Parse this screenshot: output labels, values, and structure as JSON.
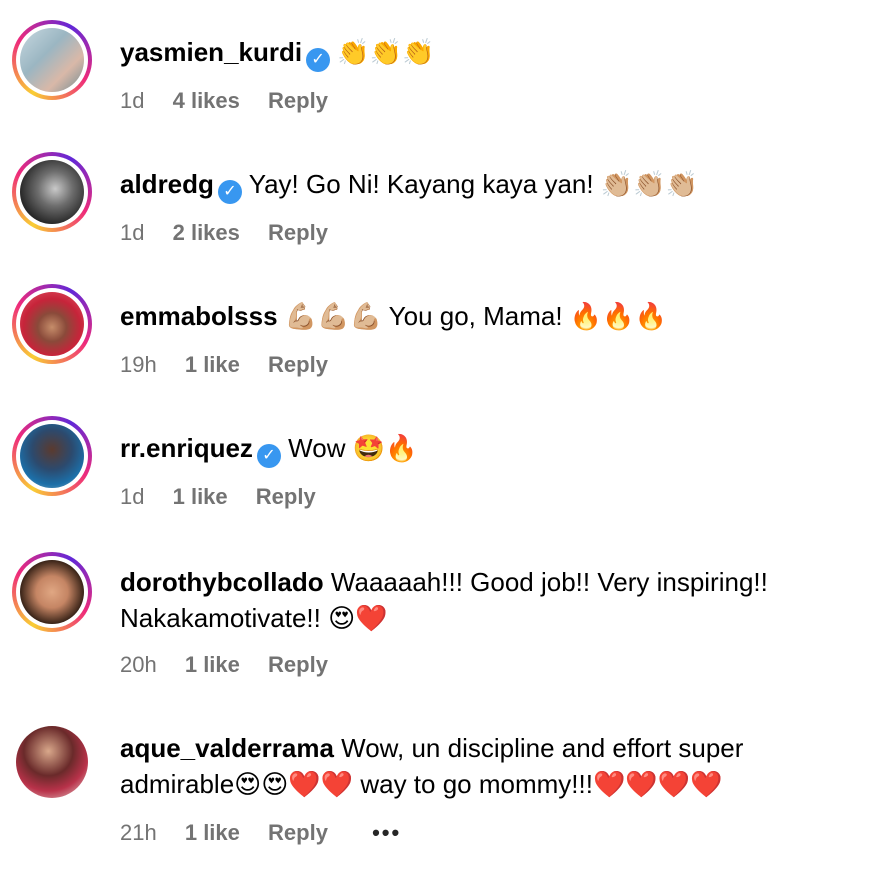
{
  "comments": [
    {
      "username": "yasmien_kurdi",
      "verified": true,
      "text": "",
      "emoji": "👏👏👏",
      "time": "1d",
      "likes": "4 likes",
      "reply": "Reply"
    },
    {
      "username": "aldredg",
      "verified": true,
      "text": "Yay! Go Ni! Kayang kaya yan!",
      "emoji": "👏🏼👏🏼👏🏼",
      "time": "1d",
      "likes": "2 likes",
      "reply": "Reply"
    },
    {
      "username": "emmabolsss",
      "verified": false,
      "pre_emoji": "💪🏼💪🏼💪🏼",
      "text": "You go, Mama!",
      "emoji": "🔥🔥🔥",
      "time": "19h",
      "likes": "1 like",
      "reply": "Reply"
    },
    {
      "username": "rr.enriquez",
      "verified": true,
      "text": "Wow",
      "emoji": "🤩🔥",
      "time": "1d",
      "likes": "1 like",
      "reply": "Reply"
    },
    {
      "username": "dorothybcollado",
      "verified": false,
      "text": "Waaaaah!!! Good job!! Very inspiring!! Nakakamotivate!!",
      "emoji": "😍❤️",
      "time": "20h",
      "likes": "1 like",
      "reply": "Reply"
    },
    {
      "username": "aque_valderrama",
      "verified": false,
      "text": "Wow, un discipline and effort super admirable😍😍❤️❤️ way to go mommy!!!❤️❤️❤️❤️",
      "time": "21h",
      "likes": "1 like",
      "reply": "Reply",
      "more": "•••"
    }
  ],
  "colors": {
    "verified_badge": "#3897f0",
    "meta_text": "#737373",
    "story_ring": [
      "#f9ce34",
      "#ee2a7b",
      "#6228d7"
    ]
  }
}
